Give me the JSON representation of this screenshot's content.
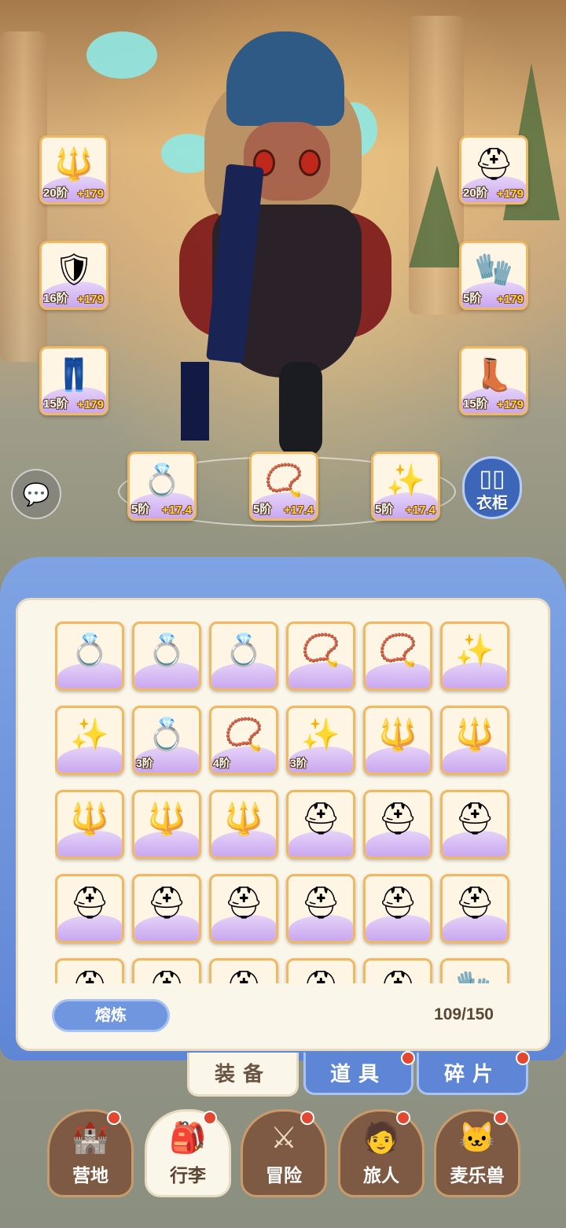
{
  "equip_slots": {
    "weapon": {
      "icon": "staff-icon",
      "tier": "20阶",
      "bonus": "+179"
    },
    "armor": {
      "icon": "armor-icon",
      "tier": "16阶",
      "bonus": "+179"
    },
    "pants": {
      "icon": "pants-icon",
      "tier": "15阶",
      "bonus": "+179"
    },
    "helmet": {
      "icon": "helmet-icon",
      "tier": "20阶",
      "bonus": "+179"
    },
    "gloves": {
      "icon": "gloves-icon",
      "tier": "5阶",
      "bonus": "+179"
    },
    "boots": {
      "icon": "boots-icon",
      "tier": "15阶",
      "bonus": "+179"
    },
    "ring": {
      "icon": "ring-icon",
      "tier": "5阶",
      "bonus": "+17.4"
    },
    "necklace": {
      "icon": "necklace-icon",
      "tier": "5阶",
      "bonus": "+17.4"
    },
    "pendant": {
      "icon": "pendant-icon",
      "tier": "5阶",
      "bonus": "+17.4"
    }
  },
  "wardrobe": {
    "label": "衣柜",
    "icon": "wardrobe-icon"
  },
  "chat": {
    "icon": "chat-icon"
  },
  "inventory": {
    "items": [
      {
        "icon": "ring-icon",
        "tier": ""
      },
      {
        "icon": "ring-icon",
        "tier": ""
      },
      {
        "icon": "ring-icon",
        "tier": ""
      },
      {
        "icon": "necklace-icon",
        "tier": ""
      },
      {
        "icon": "necklace-icon",
        "tier": ""
      },
      {
        "icon": "pendant-icon",
        "tier": ""
      },
      {
        "icon": "pendant-icon",
        "tier": ""
      },
      {
        "icon": "ring-icon",
        "tier": "3阶"
      },
      {
        "icon": "necklace-icon",
        "tier": "4阶"
      },
      {
        "icon": "pendant-icon",
        "tier": "3阶"
      },
      {
        "icon": "staff-icon",
        "tier": ""
      },
      {
        "icon": "staff-icon",
        "tier": ""
      },
      {
        "icon": "staff-icon",
        "tier": ""
      },
      {
        "icon": "staff-icon",
        "tier": ""
      },
      {
        "icon": "staff-icon",
        "tier": ""
      },
      {
        "icon": "helmet-icon",
        "tier": ""
      },
      {
        "icon": "helmet-icon",
        "tier": ""
      },
      {
        "icon": "helmet-icon",
        "tier": ""
      },
      {
        "icon": "helmet-icon",
        "tier": ""
      },
      {
        "icon": "helmet-icon",
        "tier": ""
      },
      {
        "icon": "helmet-icon",
        "tier": ""
      },
      {
        "icon": "helmet-icon",
        "tier": ""
      },
      {
        "icon": "helmet-icon",
        "tier": ""
      },
      {
        "icon": "helmet-icon",
        "tier": ""
      },
      {
        "icon": "helmet-icon",
        "tier": ""
      },
      {
        "icon": "helmet-icon",
        "tier": ""
      },
      {
        "icon": "helmet-icon",
        "tier": ""
      },
      {
        "icon": "helmet-icon",
        "tier": ""
      },
      {
        "icon": "helmet-icon",
        "tier": ""
      },
      {
        "icon": "gloves-icon",
        "tier": ""
      }
    ],
    "smelt_label": "熔炼",
    "capacity": "109/150"
  },
  "tabs": [
    {
      "label": "装备",
      "active": true,
      "badge": false
    },
    {
      "label": "道具",
      "active": false,
      "badge": true
    },
    {
      "label": "碎片",
      "active": false,
      "badge": true
    }
  ],
  "nav": [
    {
      "label": "营地",
      "icon": "castle-icon",
      "badge": true
    },
    {
      "label": "行李",
      "icon": "bag-icon",
      "badge": true,
      "active": true
    },
    {
      "label": "冒险",
      "icon": "crossed-swords-icon",
      "badge": true
    },
    {
      "label": "旅人",
      "icon": "traveler-icon",
      "badge": true
    },
    {
      "label": "麦乐兽",
      "icon": "beast-icon",
      "badge": true
    }
  ]
}
